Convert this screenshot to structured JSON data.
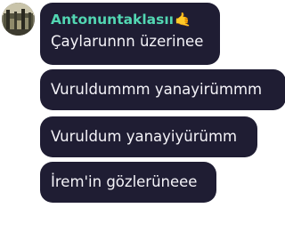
{
  "chat": {
    "sender": {
      "name": "Antonuntaklasıı",
      "emoji": "🤙",
      "name_color": "#52d6b2"
    },
    "messages": [
      {
        "text": "Çaylarunnn üzerinee"
      },
      {
        "text": "Vuruldummm yanayirümmm"
      },
      {
        "text": "Vuruldum yanayiyürümm"
      },
      {
        "text": "İrem'in gözlerüneee"
      }
    ],
    "bubble_color": "#1f1d33",
    "text_color": "#f4f3f8"
  }
}
